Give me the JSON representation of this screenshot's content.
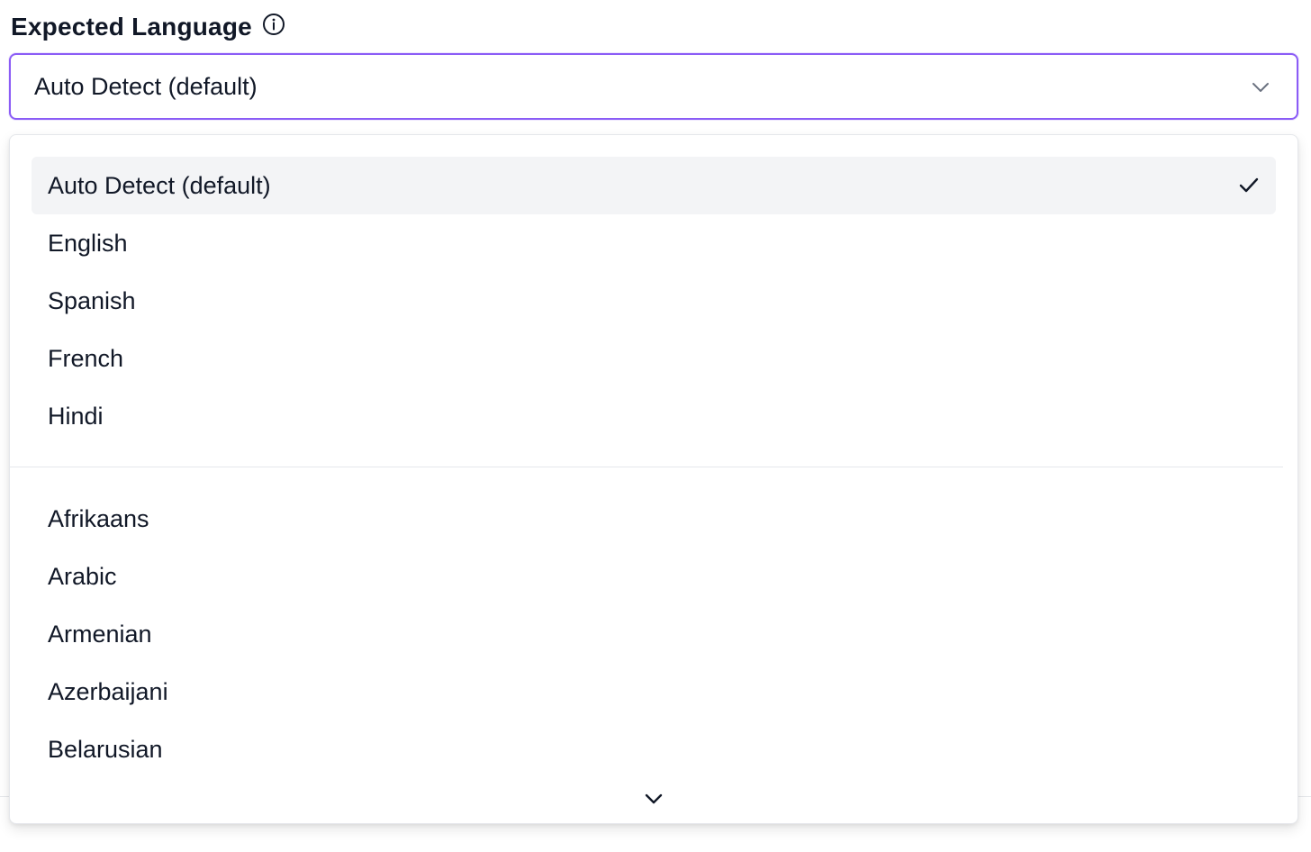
{
  "field": {
    "label": "Expected Language",
    "info_icon": "info-circle-icon"
  },
  "select": {
    "value": "Auto Detect (default)",
    "chevron_icon": "chevron-down-icon",
    "accent_color": "#8b5cf6"
  },
  "dropdown": {
    "options": [
      {
        "label": "Auto Detect (default)",
        "selected": true
      },
      {
        "label": "English"
      },
      {
        "label": "Spanish"
      },
      {
        "label": "French"
      },
      {
        "label": "Hindi"
      },
      {
        "label": "Afrikaans"
      },
      {
        "label": "Arabic"
      },
      {
        "label": "Armenian"
      },
      {
        "label": "Azerbaijani"
      },
      {
        "label": "Belarusian"
      }
    ],
    "check_icon": "check-icon",
    "scroll_icon": "chevron-down-icon"
  }
}
